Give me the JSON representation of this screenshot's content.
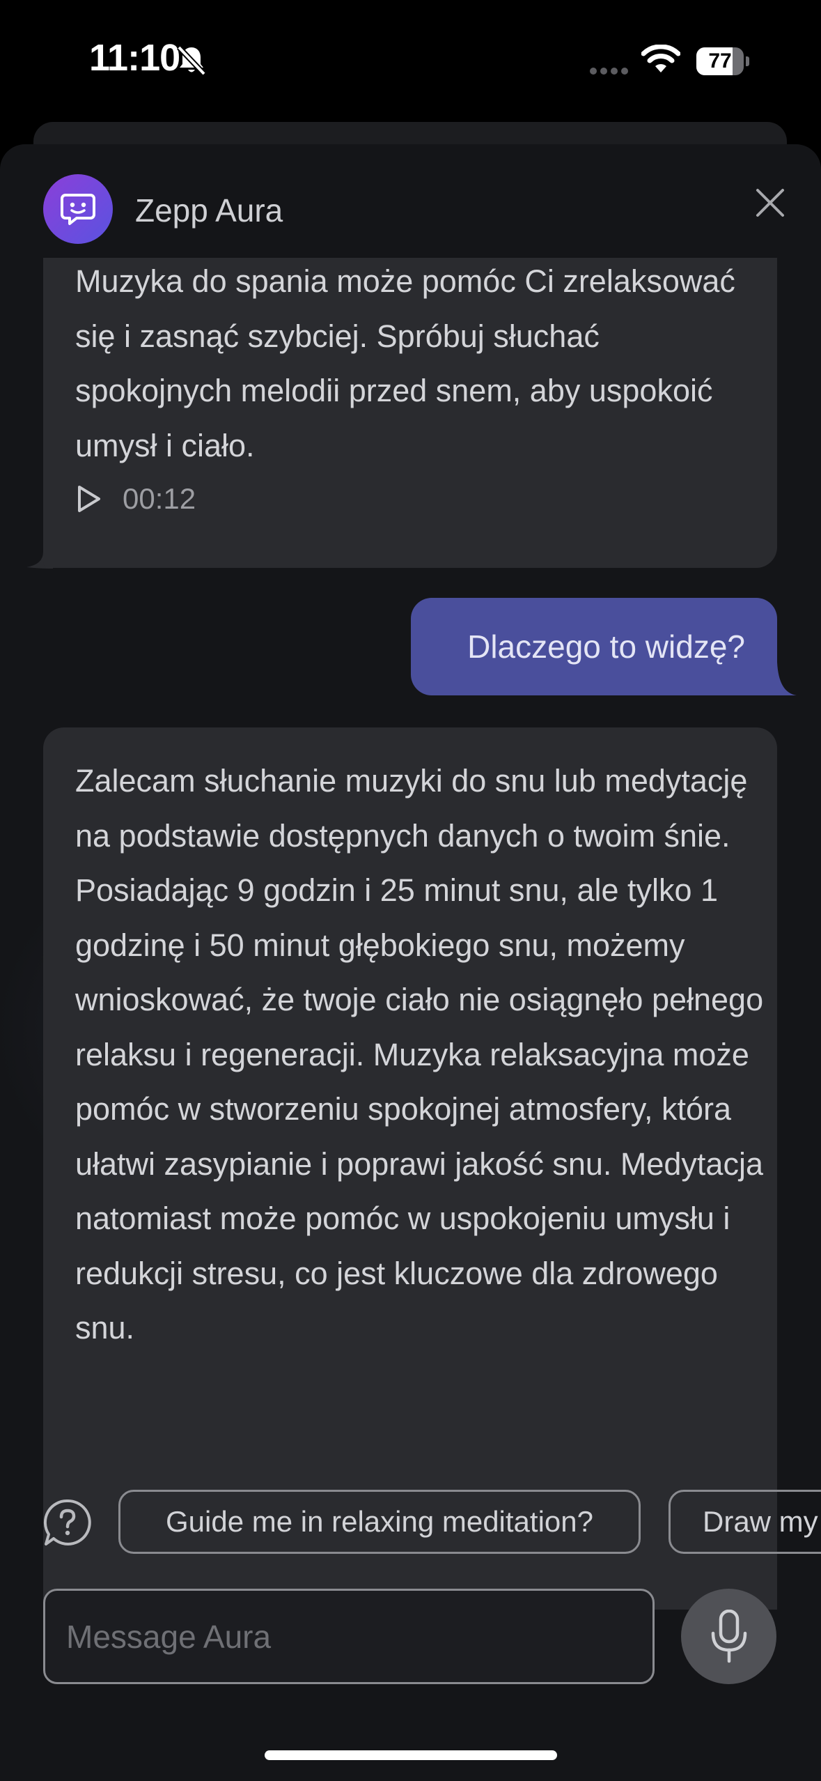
{
  "status_bar": {
    "time": "11:10",
    "battery_level": "77",
    "battery_fraction": 0.77,
    "icons": [
      "bell-slash-icon",
      "signal-icon",
      "wifi-icon",
      "battery-icon"
    ]
  },
  "header": {
    "title": "Zepp Aura",
    "avatar_icon": "chat-bubble-icon",
    "close_icon": "close-icon"
  },
  "messages": [
    {
      "sender": "assistant",
      "text": "Muzyka do spania może pomóc Ci zrelaksować się i zasnąć szybciej. Spróbuj słuchać spokojnych melodii przed snem, aby uspokoić umysł i ciało.",
      "audio_duration": "00:12"
    },
    {
      "sender": "user",
      "text": "Dlaczego to widzę?"
    },
    {
      "sender": "assistant",
      "text": "Zalecam słuchanie muzyki do snu lub medytację na podstawie dostępnych danych o twoim śnie. Posiadając 9 godzin i 25 minut snu, ale tylko 1 godzinę i 50 minut głębokiego snu, możemy wnioskować, że twoje ciało nie osiągnęło pełnego relaksu i regeneracji. Muzyka relaksacyjna może pomóc w stworzeniu spokojnej atmosfery, która ułatwi zasypianie i poprawi jakość snu. Medytacja natomiast może pomóc w uspokojeniu umysłu i redukcji stresu, co jest kluczowe dla zdrowego snu."
    }
  ],
  "suggestions": [
    "Guide me in relaxing meditation?",
    "Draw my"
  ],
  "composer": {
    "placeholder": "Message Aura",
    "value": ""
  },
  "colors": {
    "user_bubble": "#4a4f9c",
    "assistant_bubble": "#2a2b2f",
    "avatar_gradient_start": "#8b3fd9",
    "avatar_gradient_end": "#5a53e0"
  }
}
